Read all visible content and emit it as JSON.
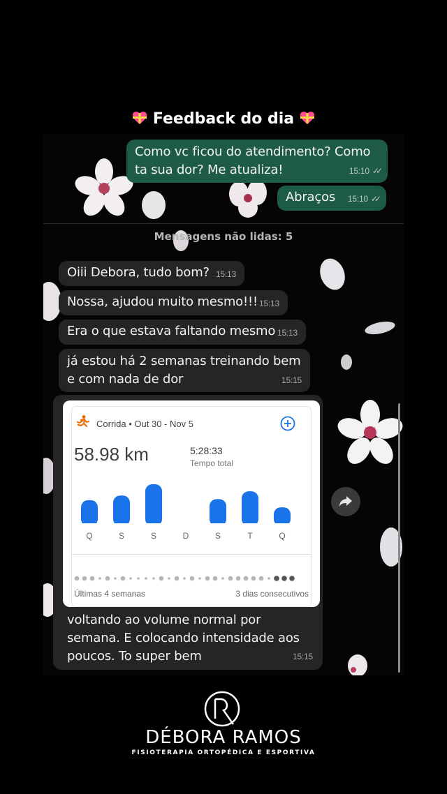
{
  "header": {
    "title": "Feedback do dia",
    "heart_icon": "heart-gift-icon"
  },
  "messages_sent": [
    {
      "text": "Como vc ficou do atendimento? Como ta sua dor? Me atualiza!",
      "time": "15:10"
    },
    {
      "text": "Abraços",
      "time": "15:10"
    }
  ],
  "unread_label": "Mensagens não lidas: 5",
  "messages_received": [
    {
      "text": "Oiii Debora, tudo bom?",
      "time": "15:13"
    },
    {
      "text": "Nossa, ajudou muito mesmo!!!",
      "time": "15:13"
    },
    {
      "text": "Era o que estava faltando mesmo",
      "time": "15:13"
    },
    {
      "text": "já estou há 2 semanas treinando bem e com nada de dor",
      "time": "15:15"
    },
    {
      "text": "voltando ao volume normal por semana. E colocando intensidade aos poucos. To super bem",
      "time": "15:15"
    }
  ],
  "fitness_card": {
    "activity": "Corrida • Out 30 - Nov 5",
    "distance": "58.98 km",
    "duration": "5:28:33",
    "duration_label": "Tempo total",
    "footer_left": "Últimas 4 semanas",
    "footer_right": "3 dias consecutivos",
    "accent": "#1a73e8",
    "activity_icon": "running-person-icon",
    "add_icon": "plus-circle-icon"
  },
  "chart_data": {
    "type": "bar",
    "categories": [
      "Q",
      "S",
      "S",
      "D",
      "S",
      "T",
      "Q"
    ],
    "values": [
      6.5,
      7.8,
      11,
      0,
      6.8,
      9,
      4.5
    ],
    "title": "",
    "xlabel": "",
    "ylabel": ""
  },
  "brand": {
    "monogram": "DR",
    "name": "DÉBORA RAMOS",
    "tagline": "FISIOTERAPIA ORTOPÉDICA E ESPORTIVA"
  }
}
